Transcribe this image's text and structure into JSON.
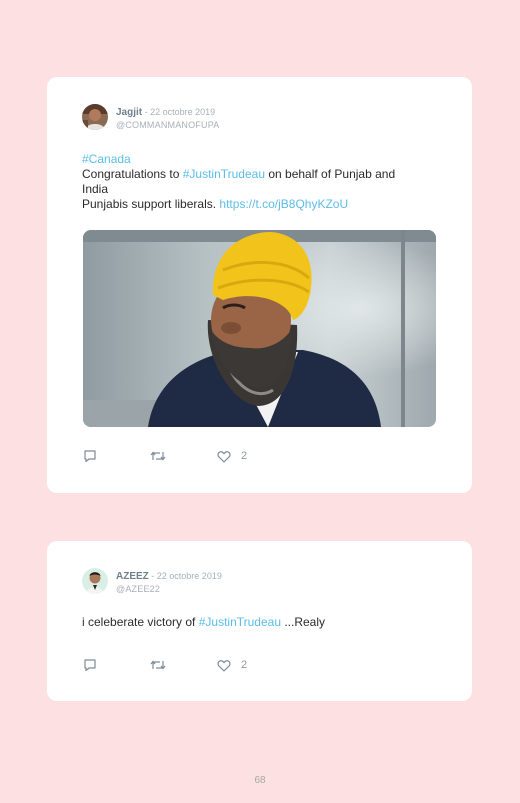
{
  "tweets": [
    {
      "name": "Jagjit",
      "date": " - 22 octobre 2019",
      "handle": "@COMMANMANOFUPA",
      "hashtag_line": "#Canada",
      "line2_pre": "Congratulations to ",
      "line2_tag": "#JustinTrudeau",
      "line2_post": " on behalf of Punjab and",
      "line3": "India",
      "line4_pre": "Punjabis support liberals. ",
      "line4_link": "https://t.co/jB8QhyKZoU",
      "likes": "2",
      "avatar_icon": "profile-photo-icon",
      "image_icon": "man-in-yellow-turban-photo"
    },
    {
      "name": "AZEEZ",
      "date": " - 22 octobre 2019",
      "handle": "@AZEE22",
      "body_pre": "i celeberate victory of ",
      "body_tag": "#JustinTrudeau",
      "body_post": " ...Realy",
      "likes": "2",
      "avatar_icon": "profile-photo-icon"
    }
  ],
  "icons": {
    "reply": "reply-icon",
    "retweet": "retweet-icon",
    "like": "heart-icon"
  },
  "colors": {
    "background": "#fde1e2",
    "link": "#5bbde8",
    "card": "#ffffff"
  },
  "page_number": "68"
}
